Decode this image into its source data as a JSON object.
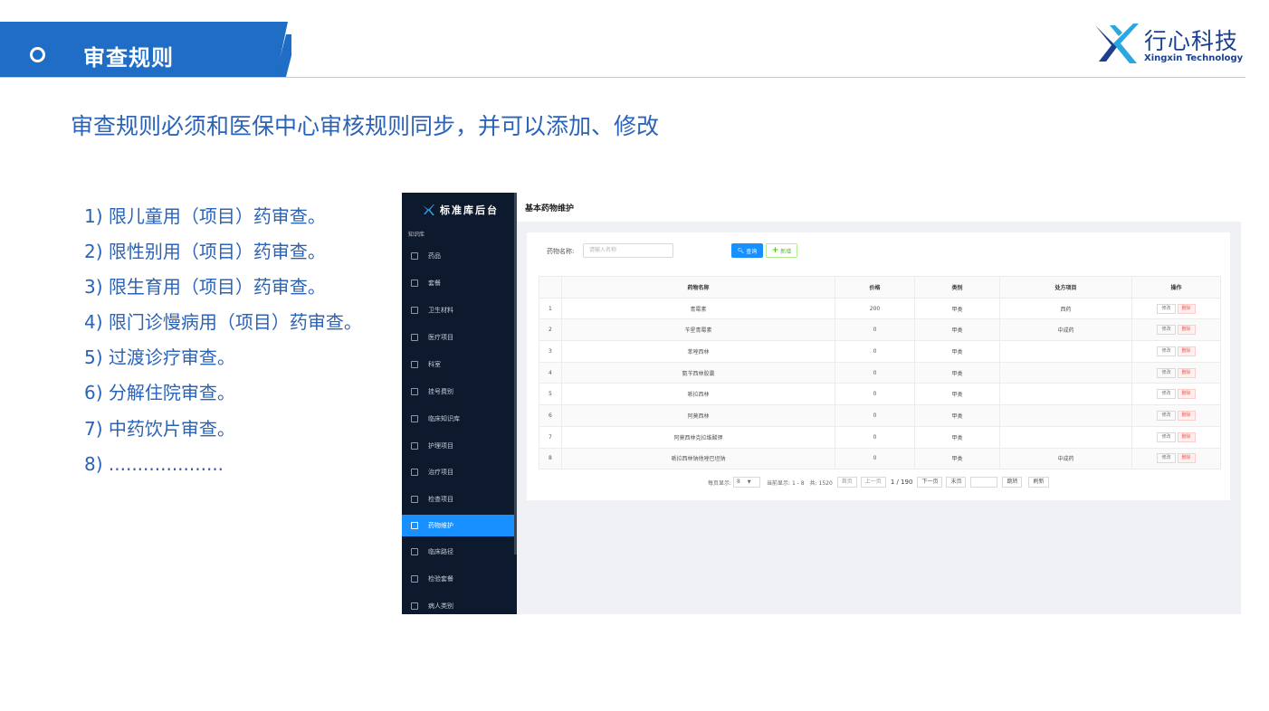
{
  "slide": {
    "title": "审查规则",
    "subtitle": "审查规则必须和医保中心审核规则同步，并可以添加、修改",
    "rules": [
      "1) 限儿童用（项目）药审查。",
      "2) 限性别用（项目）药审查。",
      "3) 限生育用（项目）药审查。",
      "4) 限门诊慢病用（项目）药审查。",
      "5) 过渡诊疗审查。",
      "6) 分解住院审查。",
      "7) 中药饮片审查。",
      "8) ...................."
    ],
    "colors": {
      "brand_blue": "#1f6dc4",
      "text_blue": "#2b63b8",
      "logo_navy": "#1b3f8f"
    }
  },
  "logo": {
    "name": "行心科技",
    "sub": "Xingxin Technology"
  },
  "app": {
    "brand": "标准库后台",
    "group_label": "知识库",
    "sidebar": [
      {
        "label": "药品",
        "icon": "link-icon"
      },
      {
        "label": "套餐",
        "icon": "grid-icon"
      },
      {
        "label": "卫生材料",
        "icon": "box-icon"
      },
      {
        "label": "医疗项目",
        "icon": "medical-icon"
      },
      {
        "label": "科室",
        "icon": "building-icon"
      },
      {
        "label": "挂号费别",
        "icon": "ticket-icon"
      },
      {
        "label": "临床知识库",
        "icon": "book-icon"
      },
      {
        "label": "护理项目",
        "icon": "puzzle-icon"
      },
      {
        "label": "治疗项目",
        "icon": "clipboard-icon"
      },
      {
        "label": "检查项目",
        "icon": "puzzle-icon"
      },
      {
        "label": "药物维护",
        "icon": "puzzle-icon",
        "active": true
      },
      {
        "label": "临床路径",
        "icon": "path-icon"
      },
      {
        "label": "检验套餐",
        "icon": "flask-icon"
      },
      {
        "label": "病人类别",
        "icon": "user-icon"
      }
    ],
    "page_title": "基本药物维护",
    "search": {
      "label": "药物名称:",
      "placeholder": "请输入名称"
    },
    "buttons": {
      "query": "查询",
      "add": "新增"
    },
    "table": {
      "headers": [
        "",
        "药物名称",
        "价格",
        "类别",
        "处方项目",
        "操作"
      ],
      "rows": [
        {
          "idx": "1",
          "name": "青霉素",
          "price": "200",
          "category": "甲类",
          "rx": "西药"
        },
        {
          "idx": "2",
          "name": "苄星青霉素",
          "price": "0",
          "category": "甲类",
          "rx": "中成药"
        },
        {
          "idx": "3",
          "name": "苯唑西林",
          "price": "0",
          "category": "甲类",
          "rx": ""
        },
        {
          "idx": "4",
          "name": "氨苄西林胶囊",
          "price": "0",
          "category": "甲类",
          "rx": ""
        },
        {
          "idx": "5",
          "name": "哌拉西林",
          "price": "0",
          "category": "甲类",
          "rx": ""
        },
        {
          "idx": "6",
          "name": "阿莫西林",
          "price": "0",
          "category": "甲类",
          "rx": ""
        },
        {
          "idx": "7",
          "name": "阿莫西林克拉维酸钾",
          "price": "0",
          "category": "甲类",
          "rx": ""
        },
        {
          "idx": "8",
          "name": "哌拉西林钠他唑巴坦钠",
          "price": "0",
          "category": "甲类",
          "rx": "中成药"
        }
      ],
      "edit_label": "修改",
      "delete_label": "删除"
    },
    "pager": {
      "per_page_label": "每页显示:",
      "per_page": "8",
      "current": "当前显示: 1 - 8",
      "total": "共: 1520",
      "first": "首页",
      "prev": "上一页",
      "page_info": "1 / 190",
      "next": "下一页",
      "last": "末页",
      "go": "跳转",
      "refresh": "刷新"
    }
  }
}
